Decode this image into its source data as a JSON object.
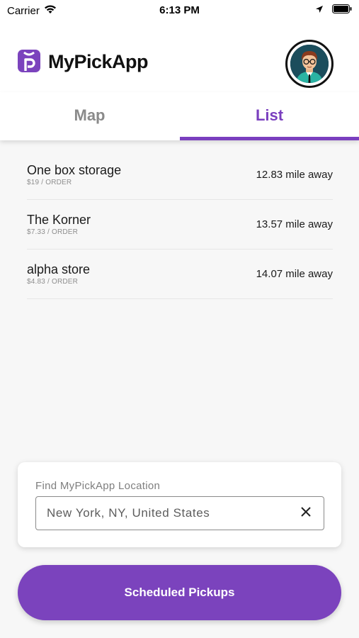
{
  "status_bar": {
    "carrier": "Carrier",
    "time": "6:13 PM"
  },
  "header": {
    "app_title": "MyPickApp",
    "brand_color": "#7b43bd"
  },
  "tabs": [
    {
      "label": "Map",
      "active": false
    },
    {
      "label": "List",
      "active": true
    }
  ],
  "stores": [
    {
      "name": "One box storage",
      "price": "$19 / ORDER",
      "distance": "12.83 mile away"
    },
    {
      "name": "The Korner",
      "price": "$7.33 / ORDER",
      "distance": "13.57 mile away"
    },
    {
      "name": "alpha store",
      "price": "$4.83 / ORDER",
      "distance": "14.07 mile away"
    }
  ],
  "search": {
    "label": "Find MyPickApp Location",
    "value": "New York, NY, United States"
  },
  "primary_button": {
    "label": "Scheduled Pickups"
  }
}
